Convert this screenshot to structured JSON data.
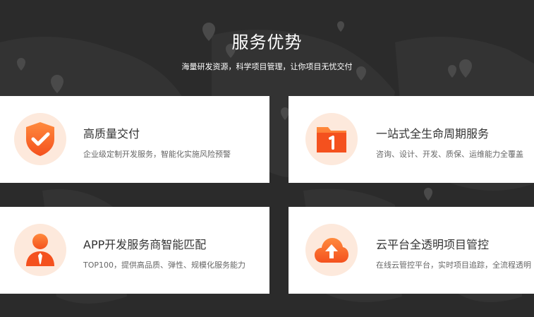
{
  "section": {
    "title": "服务优势",
    "subtitle": "海量研发资源，科学项目管理，让你项目无忧交付"
  },
  "cards": [
    {
      "icon": "shield-check-icon",
      "title": "高质量交付",
      "desc": "企业级定制开发服务，智能化实施风险预警"
    },
    {
      "icon": "folder-one-icon",
      "title": "一站式全生命周期服务",
      "desc": "咨询、设计、开发、质保、运维能力全覆盖"
    },
    {
      "icon": "user-tie-icon",
      "title": "APP开发服务商智能匹配",
      "desc": "TOP100，提供高品质、弹性、规模化服务能力"
    },
    {
      "icon": "cloud-upload-icon",
      "title": "云平台全透明项目管控",
      "desc": "在线云管控平台，实时项目追踪，全流程透明"
    }
  ],
  "colors": {
    "accent": "#f4511e",
    "accent_light": "#fde9dc",
    "background": "#2b2b2b"
  }
}
